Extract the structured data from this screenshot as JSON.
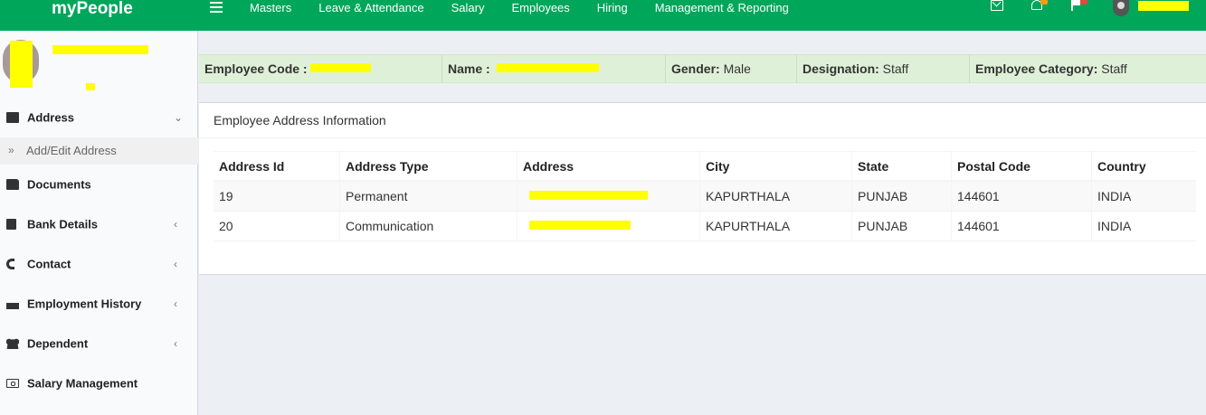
{
  "app": {
    "brand": "myPeople"
  },
  "nav": {
    "menu": [
      "Masters",
      "Leave & Attendance",
      "Salary",
      "Employees",
      "Hiring",
      "Management & Reporting"
    ],
    "icons": [
      "hamburger-icon",
      "envelope-icon",
      "bell-icon",
      "flag-icon"
    ]
  },
  "sidebar": {
    "items": [
      {
        "label": "Address",
        "icon": "envelope-icon",
        "chevron": "⌄"
      },
      {
        "label": "Documents",
        "icon": "folder-icon",
        "chevron": ""
      },
      {
        "label": "Bank Details",
        "icon": "book-icon",
        "chevron": "‹"
      },
      {
        "label": "Contact",
        "icon": "phone-icon",
        "chevron": "‹"
      },
      {
        "label": "Employment History",
        "icon": "industry-icon",
        "chevron": "‹"
      },
      {
        "label": "Dependent",
        "icon": "users-icon",
        "chevron": "‹"
      },
      {
        "label": "Salary Management",
        "icon": "money-icon",
        "chevron": ""
      }
    ],
    "subitem": {
      "arrow": "»",
      "label": "Add/Edit Address"
    }
  },
  "employee": {
    "code_label": "Employee Code :",
    "name_label": "Name :",
    "gender_label": "Gender:",
    "gender_value": "Male",
    "designation_label": "Designation:",
    "designation_value": "Staff",
    "category_label": "Employee Category:",
    "category_value": "Staff"
  },
  "address_box": {
    "title": "Employee Address Information",
    "columns": [
      "Address Id",
      "Address Type",
      "Address",
      "City",
      "State",
      "Postal Code",
      "Country"
    ],
    "rows": [
      {
        "id": "19",
        "type": "Permanent",
        "address": "",
        "city": "KAPURTHALA",
        "state": "PUNJAB",
        "postal": "144601",
        "country": "INDIA"
      },
      {
        "id": "20",
        "type": "Communication",
        "address": "",
        "city": "KAPURTHALA",
        "state": "PUNJAB",
        "postal": "144601",
        "country": "INDIA"
      }
    ]
  },
  "colors": {
    "navbar": "#00a65a",
    "emp_bar": "#dff0d8",
    "redaction": "#ffff00",
    "warning_badge": "#f39c12",
    "danger_badge": "#dd4b39"
  }
}
